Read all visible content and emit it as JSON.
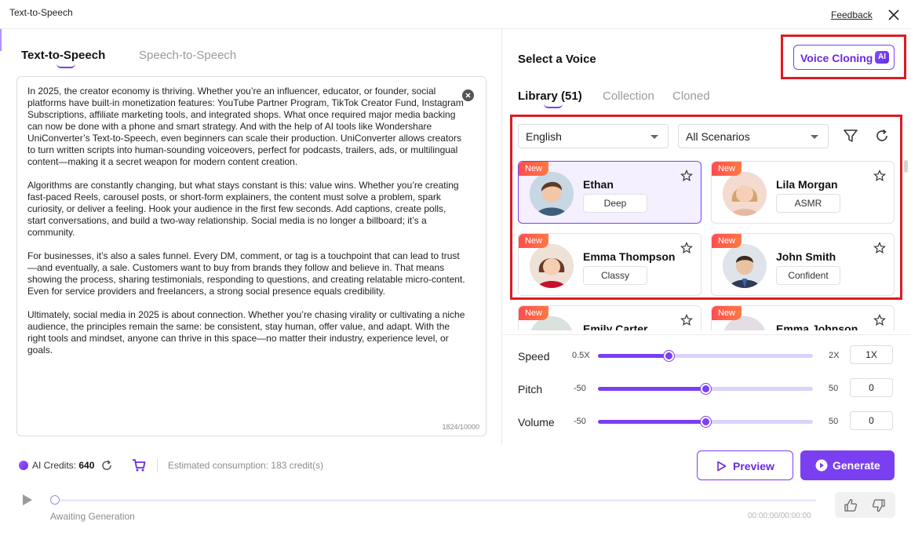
{
  "window": {
    "title": "Text-to-Speech",
    "feedback_label": "Feedback"
  },
  "left": {
    "tabs": [
      {
        "label": "Text-to-Speech",
        "active": true
      },
      {
        "label": "Speech-to-Speech",
        "active": false
      }
    ],
    "paragraphs": [
      "In 2025, the creator economy is thriving. Whether you’re an influencer, educator, or founder, social platforms have built-in monetization features: YouTube Partner Program, TikTok Creator Fund, Instagram Subscriptions, affiliate marketing tools, and integrated shops. What once required major media backing can now be done with a phone and smart strategy. And with the help of AI tools like Wondershare UniConverter’s Text-to-Speech, even beginners can scale their production. UniConverter allows creators to turn written scripts into human-sounding voiceovers, perfect for podcasts, trailers, ads, or multilingual content—making it a secret weapon for modern content creation.",
      "Algorithms are constantly changing, but what stays constant is this: value wins. Whether you’re creating fast-paced Reels, carousel posts, or short-form explainers, the content must solve a problem, spark curiosity, or deliver a feeling. Hook your audience in the first few seconds. Add captions, create polls, start conversations, and build a two-way relationship. Social media is no longer a billboard; it’s a community.",
      "For businesses, it’s also a sales funnel. Every DM, comment, or tag is a touchpoint that can lead to trust—and eventually, a sale. Customers want to buy from brands they follow and believe in. That means showing the process, sharing testimonials, responding to questions, and creating relatable micro-content. Even for service providers and freelancers, a strong social presence equals credibility.",
      "Ultimately, social media in 2025 is about connection. Whether you’re chasing virality or cultivating a niche audience, the principles remain the same: be consistent, stay human, offer value, and adapt. With the right tools and mindset, anyone can thrive in this space—no matter their industry, experience level, or goals."
    ],
    "char_count": "1824/10000"
  },
  "right": {
    "title": "Select a Voice",
    "voice_cloning_label": "Voice Cloning",
    "ai_badge": "AI",
    "tabs": [
      {
        "label": "Library (51)",
        "active": true
      },
      {
        "label": "Collection",
        "active": false
      },
      {
        "label": "Cloned",
        "active": false
      }
    ],
    "language": "English",
    "scenario": "All Scenarios",
    "voices": [
      {
        "badge": "New",
        "name": "Ethan",
        "tag": "Deep",
        "selected": true
      },
      {
        "badge": "New",
        "name": "Lila Morgan",
        "tag": "ASMR",
        "selected": false
      },
      {
        "badge": "New",
        "name": "Emma Thompson",
        "tag": "Classy",
        "selected": false
      },
      {
        "badge": "New",
        "name": "John Smith",
        "tag": "Confident",
        "selected": false
      },
      {
        "badge": "New",
        "name": "Emily Carter",
        "tag": "",
        "selected": false
      },
      {
        "badge": "New",
        "name": "Emma Johnson",
        "tag": "",
        "selected": false
      }
    ],
    "sliders": {
      "speed": {
        "label": "Speed",
        "min": "0.5X",
        "max": "2X",
        "value": "1X",
        "fraction": 0.33
      },
      "pitch": {
        "label": "Pitch",
        "min": "-50",
        "max": "50",
        "value": "0",
        "fraction": 0.5
      },
      "volume": {
        "label": "Volume",
        "min": "-50",
        "max": "50",
        "value": "0",
        "fraction": 0.5
      }
    }
  },
  "bottom": {
    "credits_label": "AI Credits:",
    "credits_value": "640",
    "estimate": "Estimated consumption: 183 credit(s)",
    "preview_label": "Preview",
    "generate_label": "Generate",
    "status": "Awaiting Generation",
    "timer": "00:00:00/00:00:00"
  },
  "colors": {
    "accent": "#7b3ff2",
    "highlight_box": "#e01a22",
    "new_badge": "#ff4d4f"
  }
}
